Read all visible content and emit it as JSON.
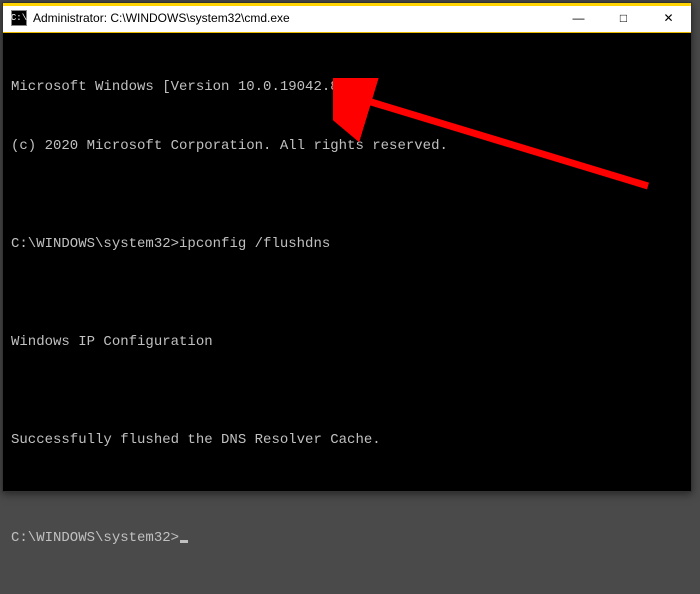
{
  "window": {
    "title": "Administrator: C:\\WINDOWS\\system32\\cmd.exe",
    "icon_label": "C:\\"
  },
  "controls": {
    "minimize": "—",
    "maximize": "□",
    "close": "✕"
  },
  "terminal": {
    "line1": "Microsoft Windows [Version 10.0.19042.870]",
    "line2": "(c) 2020 Microsoft Corporation. All rights reserved.",
    "blank1": "",
    "prompt1_path": "C:\\WINDOWS\\system32>",
    "prompt1_cmd": "ipconfig /flushdns",
    "blank2": "",
    "line3": "Windows IP Configuration",
    "blank3": "",
    "line4": "Successfully flushed the DNS Resolver Cache.",
    "blank4": "",
    "prompt2_path": "C:\\WINDOWS\\system32>"
  },
  "annotation": {
    "color": "#ff0000"
  },
  "watermark": ""
}
